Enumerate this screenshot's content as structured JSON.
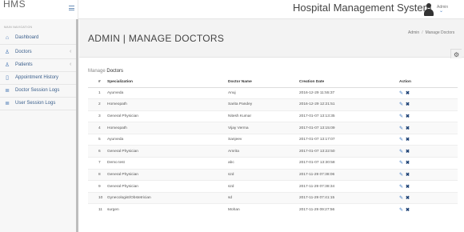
{
  "brand": "HMS",
  "app_title": "Hospital Management System",
  "user": {
    "name": "Admin",
    "chevron": "⌄"
  },
  "sidebar": {
    "heading": "MAIN NAVIGATION",
    "items": [
      {
        "label": "Dashboard",
        "icon": "home-icon",
        "glyph": "⌂",
        "chevron": ""
      },
      {
        "label": "Doctors",
        "icon": "user-icon",
        "glyph": "♙",
        "chevron": "‹"
      },
      {
        "label": "Patients",
        "icon": "user-icon",
        "glyph": "♙",
        "chevron": "‹"
      },
      {
        "label": "Appointment History",
        "icon": "file-icon",
        "glyph": "▯",
        "chevron": ""
      },
      {
        "label": "Doctor Session Logs",
        "icon": "list-icon",
        "glyph": "≣",
        "chevron": ""
      },
      {
        "label": "User Session Logs",
        "icon": "list-icon",
        "glyph": "≣",
        "chevron": ""
      }
    ]
  },
  "page": {
    "title": "ADMIN | MANAGE DOCTORS",
    "breadcrumb": [
      "Admin",
      "Manage Doctors"
    ],
    "breadcrumb_sep": "/",
    "section_prefix": "Manage",
    "section_title": "Doctors"
  },
  "table": {
    "headers": [
      "#",
      "Specialization",
      "Doctor Name",
      "Creation Date",
      "Action"
    ],
    "rows": [
      [
        "1",
        "Ayurveda",
        "Anuj",
        "2016-12-29 11:55:37"
      ],
      [
        "2",
        "Homeopath",
        "Sarita Pandey",
        "2016-12-29 12:21:51"
      ],
      [
        "3",
        "General Physician",
        "Nitesh Kumar",
        "2017-01-07 13:13:35"
      ],
      [
        "4",
        "Homeopath",
        "Vijay Verma",
        "2017-01-07 13:15:09"
      ],
      [
        "5",
        "Ayurveda",
        "Sanjeev",
        "2017-01-07 13:17:07"
      ],
      [
        "6",
        "General Physician",
        "Amrita",
        "2017-01-07 13:22:50"
      ],
      [
        "7",
        "Demo test",
        "abc",
        "2017-01-07 13:30:58"
      ],
      [
        "8",
        "General Physician",
        "szd",
        "2017-11-29 07:38:06"
      ],
      [
        "9",
        "General Physician",
        "szd",
        "2017-11-29 07:38:34"
      ],
      [
        "10",
        "Gynecologist/Obstetrician",
        "sd",
        "2017-11-29 07:41:15"
      ],
      [
        "11",
        "surgen",
        "Mohan",
        "2017-11-29 09:27:56"
      ]
    ],
    "edit_glyph": "✎",
    "delete_glyph": "✖"
  },
  "settings_glyph": "⚙"
}
